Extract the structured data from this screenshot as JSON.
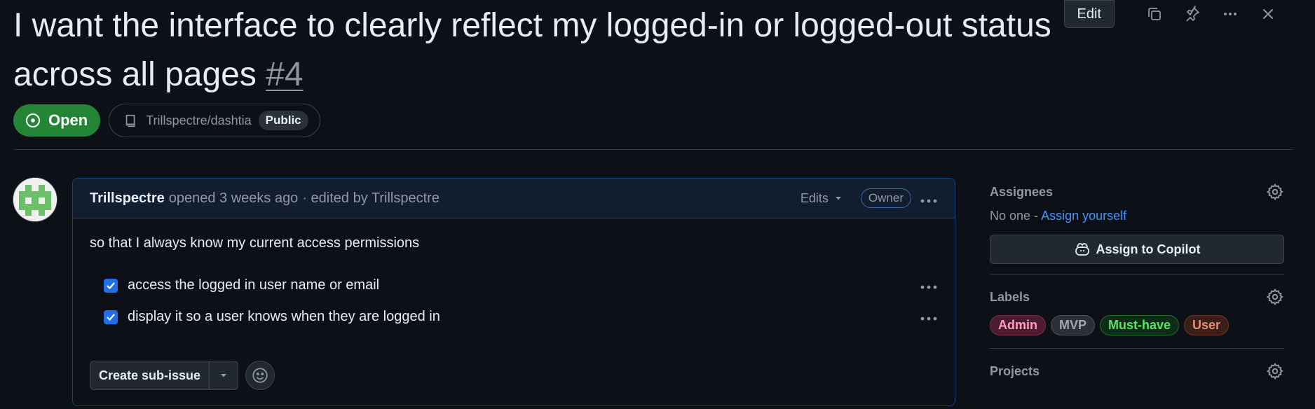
{
  "issue": {
    "title": "I want the interface to clearly reflect my logged-in or logged-out status across all pages",
    "number": "#4",
    "state": "Open",
    "repo": "Trillspectre/dashtia",
    "visibility": "Public"
  },
  "toolbar": {
    "edit_label": "Edit",
    "icons": [
      "copy-icon",
      "pin-icon",
      "kebab-icon",
      "close-icon"
    ]
  },
  "comment": {
    "author": "Trillspectre",
    "opened": "opened 3 weeks ago",
    "edited": "· edited by Trillspectre",
    "edits_label": "Edits",
    "role_badge": "Owner",
    "body": "so that I always know my current access permissions",
    "tasks": [
      {
        "label": "access the logged in user name or email",
        "checked": true
      },
      {
        "label": "display it so a user knows when they are logged in",
        "checked": true
      }
    ],
    "create_sub_issue_label": "Create sub-issue"
  },
  "sidebar": {
    "assignees": {
      "title": "Assignees",
      "none_text": "No one -",
      "assign_link": "Assign yourself",
      "copilot_button": "Assign to Copilot"
    },
    "labels": {
      "title": "Labels",
      "items": [
        {
          "name": "Admin",
          "color": "#ff9ec0"
        },
        {
          "name": "MVP",
          "color": "#a0a8b2"
        },
        {
          "name": "Must-have",
          "color": "#5ee06a"
        },
        {
          "name": "User",
          "color": "#e38f75"
        }
      ]
    },
    "projects": {
      "title": "Projects"
    }
  },
  "colors": {
    "background": "#0d1117",
    "open_green": "#238636",
    "link_blue": "#4493f8",
    "checkbox_blue": "#1f6feb"
  }
}
